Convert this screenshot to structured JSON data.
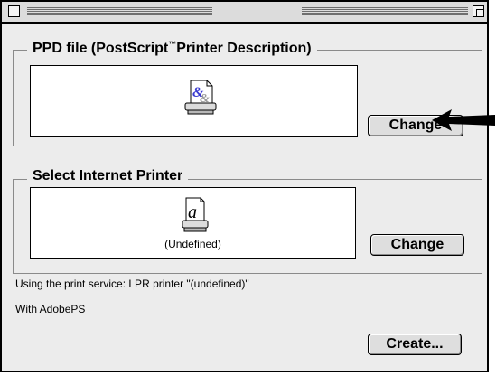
{
  "window": {
    "title": "",
    "close_icon": "close-box-icon",
    "zoom_icon": "zoom-box-icon"
  },
  "ppd_section": {
    "label_main": "PPD file (PostScript",
    "label_tm": "™",
    "label_rest": "Printer Description)",
    "icon": "ppd-document-icon",
    "change_button": "Change"
  },
  "printer_section": {
    "label": "Select Internet Printer",
    "icon": "printer-icon",
    "printer_name": "(Undefined)",
    "change_button": "Change"
  },
  "info": {
    "line1": "Using the print service: LPR printer \"(undefined)\"",
    "line2": "With AdobePS"
  },
  "create_button": "Create...",
  "annotation": {
    "icon": "pointer-arrow-icon",
    "color": "#000000"
  }
}
